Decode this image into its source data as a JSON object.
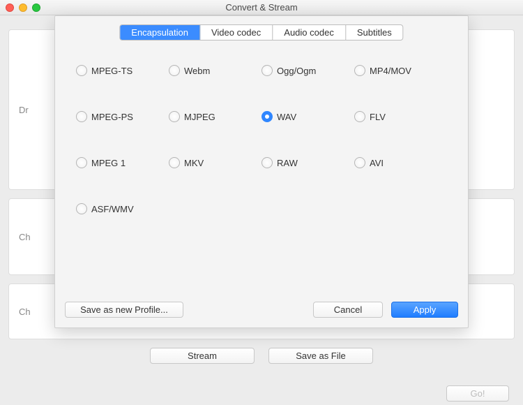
{
  "titlebar": {
    "title": "Convert & Stream"
  },
  "background": {
    "panel1_hint": "Dr",
    "panel2_hint": "Ch",
    "panel3_hint": "Ch",
    "stream_button": "Stream",
    "save_file_button": "Save as File",
    "go_button": "Go!"
  },
  "sheet": {
    "tabs": [
      {
        "label": "Encapsulation",
        "active": true
      },
      {
        "label": "Video codec",
        "active": false
      },
      {
        "label": "Audio codec",
        "active": false
      },
      {
        "label": "Subtitles",
        "active": false
      }
    ],
    "radios": [
      {
        "label": "MPEG-TS",
        "selected": false
      },
      {
        "label": "Webm",
        "selected": false
      },
      {
        "label": "Ogg/Ogm",
        "selected": false
      },
      {
        "label": "MP4/MOV",
        "selected": false
      },
      {
        "label": "MPEG-PS",
        "selected": false
      },
      {
        "label": "MJPEG",
        "selected": false
      },
      {
        "label": "WAV",
        "selected": true
      },
      {
        "label": "FLV",
        "selected": false
      },
      {
        "label": "MPEG 1",
        "selected": false
      },
      {
        "label": "MKV",
        "selected": false
      },
      {
        "label": "RAW",
        "selected": false
      },
      {
        "label": "AVI",
        "selected": false
      },
      {
        "label": "ASF/WMV",
        "selected": false
      }
    ],
    "buttons": {
      "save_profile": "Save as new Profile...",
      "cancel": "Cancel",
      "apply": "Apply"
    }
  }
}
